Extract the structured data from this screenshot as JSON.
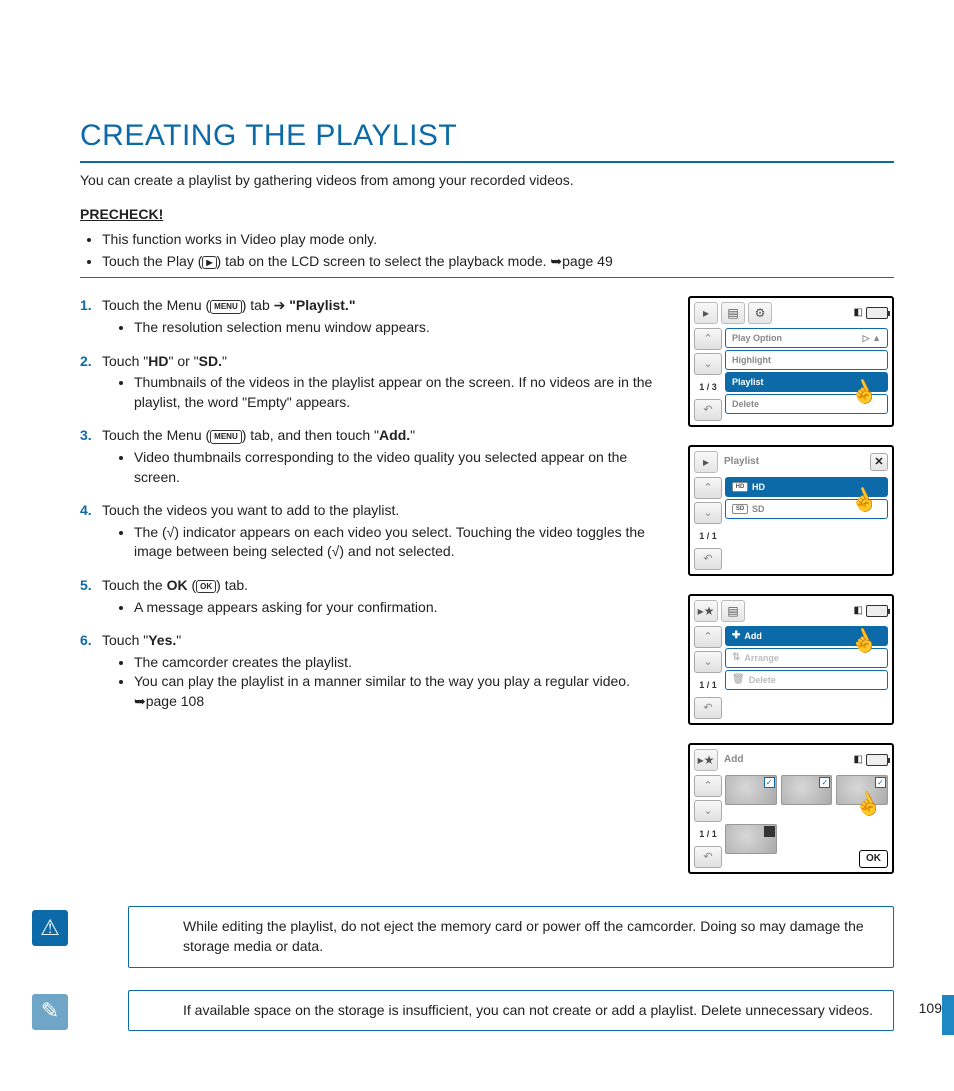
{
  "title": "CREATING THE PLAYLIST",
  "intro": "You can create a playlist by gathering videos from among your recorded videos.",
  "precheck_label": "PRECHECK!",
  "precheck": {
    "item1": "This function works in Video play mode only.",
    "item2_a": "Touch the Play (",
    "item2_b": ") tab on the LCD screen to select the playback mode. ",
    "item2_c": "page 49"
  },
  "steps": {
    "s1": {
      "a": "Touch the Menu (",
      "b": ") tab ",
      "arrow": "➔",
      "c": " \"Playlist.\"",
      "bullet": "The resolution selection menu window appears."
    },
    "s2": {
      "a": "Touch \"",
      "hd": "HD",
      "b": "\" or \"",
      "sd": "SD.",
      "c": "\"",
      "bullet": "Thumbnails of the videos in the playlist appear on the screen. If no videos are in the playlist, the word \"Empty\" appears."
    },
    "s3": {
      "a": "Touch the Menu (",
      "b": ") tab, and then touch \"",
      "add": "Add.",
      "c": "\"",
      "bullet": "Video thumbnails corresponding to the video quality you selected appear on the screen."
    },
    "s4": {
      "a": "Touch the videos you want to add to the playlist.",
      "bullet": "The (√) indicator appears on each video you select. Touching the video toggles the image between being selected (√) and not selected."
    },
    "s5": {
      "a": "Touch the ",
      "ok": "OK",
      "b": " (",
      "c": ") tab.",
      "bullet": "A message appears asking for your confirmation."
    },
    "s6": {
      "a": "Touch \"",
      "yes": "Yes.",
      "b": "\"",
      "bullet1": "The camcorder creates the playlist.",
      "bullet2a": "You can play the playlist in a manner similar to the way you play a regular video. ",
      "bullet2b": "page 108"
    }
  },
  "menu_chip": "MENU",
  "ok_chip": "OK",
  "play_chip": "▶",
  "panels": {
    "p1": {
      "page": "1 / 3",
      "rows": [
        "Play Option",
        "Highlight",
        "Playlist",
        "Delete"
      ],
      "selected": 2
    },
    "p2": {
      "title": "Playlist",
      "page": "1 / 1",
      "rows": [
        "HD",
        "SD"
      ],
      "hd_chip": "HD",
      "sd_chip": "SD"
    },
    "p3": {
      "page": "1 / 1",
      "rows": [
        "Add",
        "Arrange",
        "Delete"
      ],
      "selected": 0
    },
    "p4": {
      "title": "Add",
      "page": "1 / 1",
      "ok": "OK"
    }
  },
  "callout_warn": "While editing the playlist, do not eject the memory card or power off the camcorder. Doing so may damage the storage media or data.",
  "callout_note": "If available space on the storage is insufficient, you can not create or add a playlist. Delete unnecessary videos.",
  "page_number": "109"
}
